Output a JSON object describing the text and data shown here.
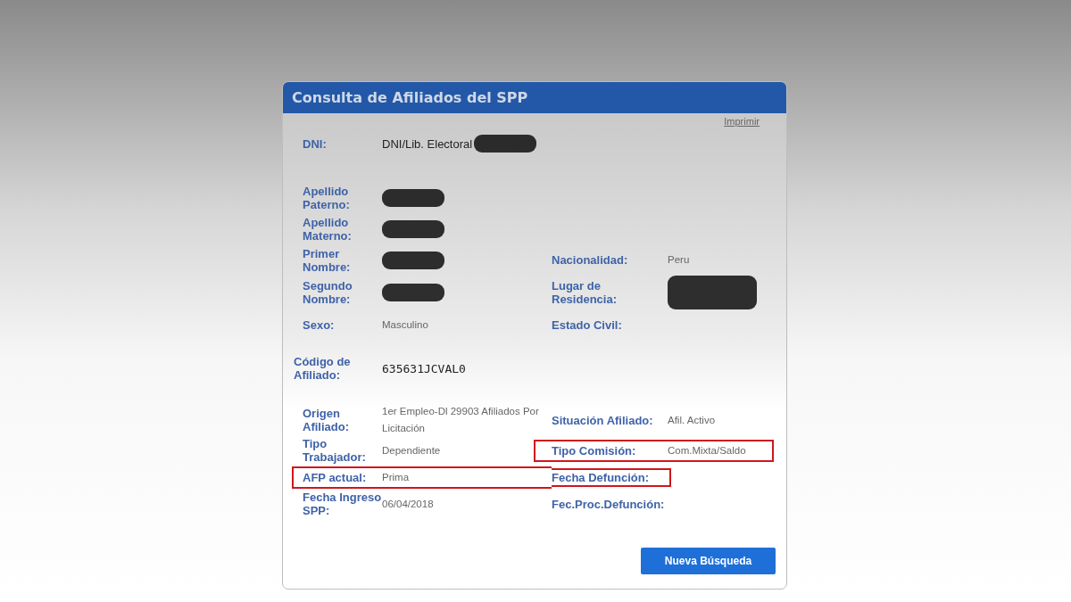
{
  "panel": {
    "title": "Consulta de Afiliados del SPP",
    "print_link": "Imprimir"
  },
  "sections": [
    {
      "rows": [
        {
          "left": {
            "label": "DNI:",
            "value": "DNI/Lib. Electoral",
            "kind": "document",
            "redacted": true
          }
        }
      ]
    },
    {
      "rows": [
        {
          "left": {
            "label": "Apellido Paterno:",
            "redacted": true
          }
        },
        {
          "left": {
            "label": "Apellido Materno:",
            "redacted": true
          }
        },
        {
          "left": {
            "label": "Primer Nombre:",
            "redacted": true
          },
          "right": {
            "label": "Nacionalidad:",
            "value": "Peru"
          }
        },
        {
          "left": {
            "label": "Segundo Nombre:",
            "redacted": true
          },
          "right": {
            "label": "Lugar de Residencia:",
            "redacted": true
          }
        },
        {
          "left": {
            "label": "Sexo:",
            "value": "Masculino"
          },
          "right": {
            "label": "Estado Civil:"
          }
        }
      ]
    },
    {
      "rows": [
        {
          "left": {
            "label": "Código de Afiliado:",
            "value": "635631JCVAL0",
            "kind": "code"
          }
        }
      ]
    },
    {
      "rows": [
        {
          "left": {
            "label": "Origen Afiliado:",
            "value": "1er Empleo-Dl 29903 Afiliados Por Licitación"
          },
          "right": {
            "label": "Situación Afiliado:",
            "value": "Afil. Activo"
          }
        },
        {
          "left": {
            "label": "Tipo Trabajador:",
            "value": "Dependiente"
          },
          "right": {
            "label": "Tipo Comisión:",
            "value": "Com.Mixta/Saldo",
            "highlighted": true
          }
        },
        {
          "left": {
            "label": "AFP actual:",
            "value": "Prima",
            "highlighted": true
          },
          "right": {
            "label": "Fecha Defunción:",
            "highlighted": true
          }
        },
        {
          "left": {
            "label": "Fecha Ingreso SPP:",
            "value": "06/04/2018"
          },
          "right": {
            "label": "Fec.Proc.Defunción:"
          }
        }
      ]
    }
  ],
  "button": "Nueva Búsqueda"
}
